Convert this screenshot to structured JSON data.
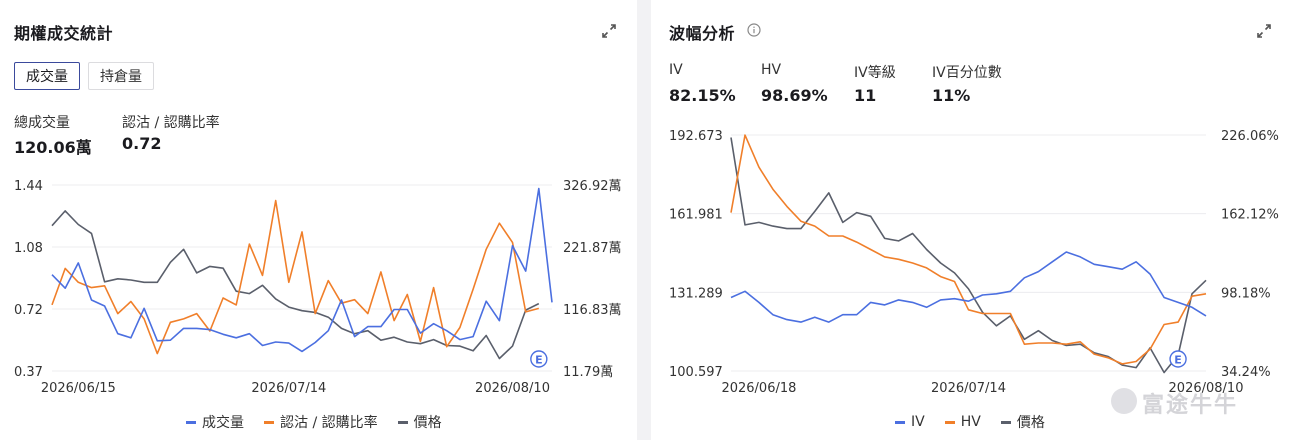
{
  "left_panel": {
    "title": "期權成交統計",
    "tabs": [
      {
        "label": "成交量",
        "active": true
      },
      {
        "label": "持倉量",
        "active": false
      }
    ],
    "stats": [
      {
        "label": "總成交量",
        "value": "120.06萬"
      },
      {
        "label": "認沽 / 認購比率",
        "value": "0.72"
      }
    ]
  },
  "right_panel": {
    "title": "波幅分析",
    "stats": [
      {
        "label": "IV",
        "value": "82.15%"
      },
      {
        "label": "HV",
        "value": "98.69%"
      },
      {
        "label": "IV等級",
        "value": "11"
      },
      {
        "label": "IV百分位數",
        "value": "11%"
      }
    ]
  },
  "colors": {
    "blue": "#4b6fe0",
    "orange": "#f07f2a",
    "gray": "#5a5f6b",
    "grid": "#ececef",
    "axis_text": "#333333"
  },
  "icons": [
    "expand-icon",
    "info-icon",
    "earnings-marker-icon"
  ],
  "watermark": "富途牛牛",
  "chart_data": [
    {
      "type": "line",
      "earnings_marker": "E",
      "earnings_index": 37,
      "x_ticks": [
        {
          "index": 2,
          "label": "2026/06/15"
        },
        {
          "index": 18,
          "label": "2026/07/14"
        },
        {
          "index": 35,
          "label": "2026/08/10"
        }
      ],
      "y_left": {
        "ticks": [
          "1.44",
          "1.08",
          "0.72",
          "0.37"
        ],
        "range": [
          0.37,
          1.44
        ]
      },
      "y_right": {
        "ticks": [
          "326.92萬",
          "221.87萬",
          "116.83萬",
          "11.79萬"
        ],
        "range": [
          11.79,
          326.92
        ],
        "unit": "萬"
      },
      "series": [
        {
          "name": "成交量",
          "axis": "right",
          "color": "#4b6fe0",
          "values": [
            175,
            152,
            195,
            132,
            122,
            75,
            68,
            118,
            63,
            64,
            84,
            84,
            82,
            74,
            68,
            75,
            55,
            61,
            59,
            45,
            60,
            80,
            132,
            70,
            87,
            87,
            116,
            116,
            76,
            92,
            80,
            65,
            70,
            130,
            97,
            224,
            181,
            321,
            128
          ]
        },
        {
          "name": "認沽 / 認購比率",
          "axis": "left",
          "color": "#f07f2a",
          "values": [
            0.75,
            0.96,
            0.88,
            0.85,
            0.86,
            0.7,
            0.77,
            0.67,
            0.47,
            0.65,
            0.67,
            0.7,
            0.6,
            0.79,
            0.75,
            1.1,
            0.92,
            1.35,
            0.88,
            1.17,
            0.7,
            0.89,
            0.76,
            0.78,
            0.7,
            0.94,
            0.66,
            0.81,
            0.54,
            0.85,
            0.51,
            0.62,
            0.84,
            1.07,
            1.22,
            1.11,
            0.71,
            0.73
          ]
        },
        {
          "name": "價格",
          "axis": "right",
          "color": "#5a5f6b",
          "values": [
            258,
            283,
            260,
            245,
            163,
            168,
            166,
            162,
            162,
            196,
            218,
            178,
            189,
            186,
            147,
            143,
            157,
            134,
            120,
            114,
            111,
            103,
            84,
            75,
            80,
            64,
            69,
            61,
            58,
            65,
            55,
            54,
            46,
            72,
            33,
            54,
            115,
            126
          ]
        }
      ]
    },
    {
      "type": "line",
      "earnings_marker": "E",
      "earnings_index": 32,
      "x_ticks": [
        {
          "index": 2,
          "label": "2026/06/18"
        },
        {
          "index": 17,
          "label": "2026/07/14"
        },
        {
          "index": 34,
          "label": "2026/08/10"
        }
      ],
      "y_left": {
        "ticks": [
          "192.673",
          "161.981",
          "131.289",
          "100.597"
        ],
        "range": [
          100.597,
          192.673
        ]
      },
      "y_right": {
        "ticks": [
          "226.06%",
          "162.12%",
          "98.18%",
          "34.24%"
        ],
        "range": [
          34.24,
          226.06
        ],
        "unit": "%"
      },
      "series": [
        {
          "name": "IV",
          "axis": "right",
          "color": "#4b6fe0",
          "values": [
            94,
            99,
            90,
            80,
            76,
            74,
            78,
            74,
            80,
            80,
            90,
            88,
            92,
            90,
            86,
            92,
            93,
            91,
            96,
            97,
            99,
            110,
            115,
            123,
            131,
            127,
            121,
            119,
            117,
            123,
            113,
            94,
            90,
            86,
            79
          ]
        },
        {
          "name": "HV",
          "axis": "right",
          "color": "#f07f2a",
          "values": [
            163,
            226,
            200,
            182,
            168,
            156,
            152,
            144,
            144,
            139,
            133,
            127,
            125,
            122,
            118,
            111,
            107,
            84,
            81,
            81,
            81,
            56,
            57,
            57,
            56,
            58,
            48,
            45,
            40,
            42,
            52,
            72,
            74,
            95,
            97
          ]
        },
        {
          "name": "價格",
          "axis": "right",
          "color": "#5a5f6b",
          "values": [
            224,
            153,
            155,
            152,
            150,
            150,
            164,
            179,
            155,
            163,
            160,
            142,
            140,
            146,
            133,
            122,
            114,
            101,
            82,
            71,
            79,
            60,
            67,
            59,
            55,
            56,
            49,
            46,
            39,
            37,
            53,
            33,
            47,
            97,
            108
          ]
        }
      ]
    }
  ]
}
